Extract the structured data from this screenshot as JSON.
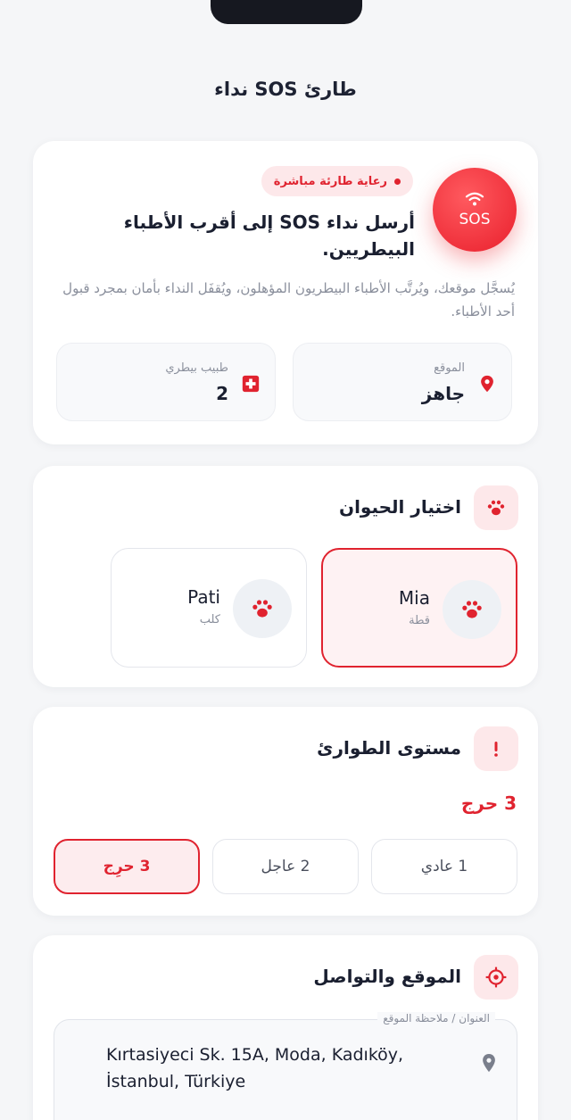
{
  "page": {
    "title": "نداء SOS طارئ"
  },
  "hero": {
    "sos_label": "SOS",
    "badge": "رعاية طارئة مباشرة",
    "headline": "أرسل نداء SOS إلى أقرب الأطباء البيطريين.",
    "description": "يُسجَّل موقعك، ويُرتَّب الأطباء البيطريون المؤهلون، ويُقفَل النداء بأمان بمجرد قبول أحد الأطباء.",
    "location": {
      "label": "الموقع",
      "value": "جاهز",
      "icon": "map-pin-icon"
    },
    "vets": {
      "label": "طبيب بيطري",
      "value": "2",
      "icon": "medical-cross-icon"
    }
  },
  "pets": {
    "title": "اختيار الحيوان",
    "icon": "paw-icon",
    "items": [
      {
        "name": "Mia",
        "type": "قطة",
        "selected": true
      },
      {
        "name": "Pati",
        "type": "كلب",
        "selected": false
      }
    ]
  },
  "emergency": {
    "title": "مستوى الطوارئ",
    "icon": "exclamation-icon",
    "current": "3 حرج",
    "levels": [
      "1 عادي",
      "2 عاجل",
      "3 حرِج"
    ],
    "selected_index": 2
  },
  "contact": {
    "title": "الموقع والتواصل",
    "icon": "target-icon",
    "address_label": "العنوان / ملاحظة الموقع",
    "address_value": "Kırtasiyeci Sk. 15A, Moda, Kadıköy, İstanbul, Türkiye"
  },
  "colors": {
    "accent": "#e0232f",
    "accent_soft": "#fde8ea"
  }
}
